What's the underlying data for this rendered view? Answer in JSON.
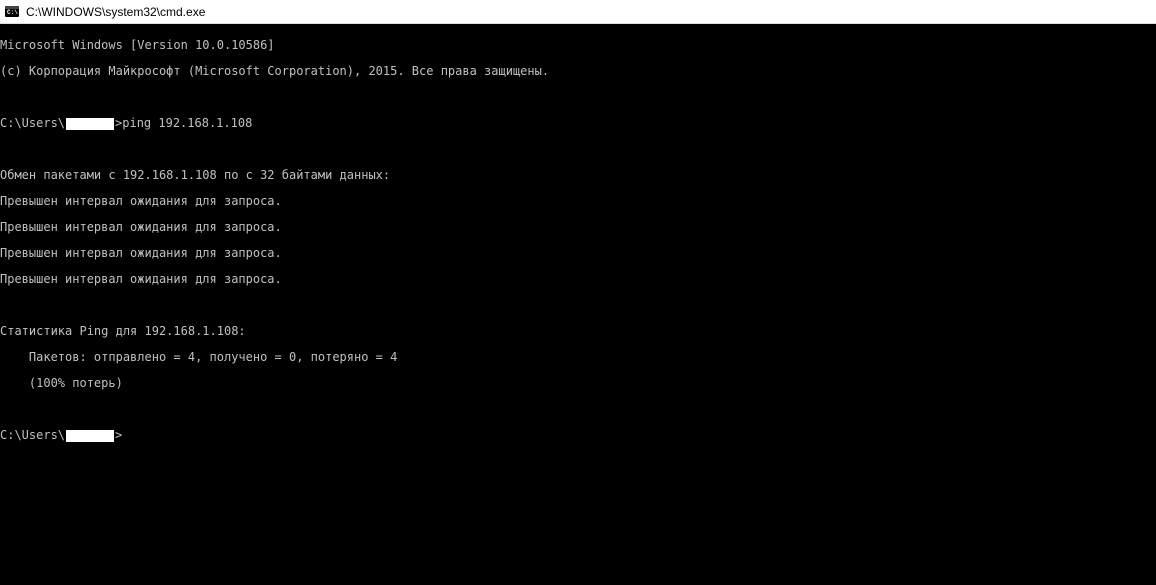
{
  "titlebar": {
    "title": "C:\\WINDOWS\\system32\\cmd.exe",
    "icon_label": "C:\\"
  },
  "terminal": {
    "header_line1": "Microsoft Windows [Version 10.0.10586]",
    "header_line2": "(c) Корпорация Майкрософт (Microsoft Corporation), 2015. Все права защищены.",
    "prompt1_prefix": "C:\\Users\\",
    "prompt1_command": ">ping 192.168.1.108",
    "output_exchange": "Обмен пакетами с 192.168.1.108 по с 32 байтами данных:",
    "output_timeout1": "Превышен интервал ожидания для запроса.",
    "output_timeout2": "Превышен интервал ожидания для запроса.",
    "output_timeout3": "Превышен интервал ожидания для запроса.",
    "output_timeout4": "Превышен интервал ожидания для запроса.",
    "output_stats_header": "Статистика Ping для 192.168.1.108:",
    "output_stats_packets": "    Пакетов: отправлено = 4, получено = 0, потеряно = 4",
    "output_stats_loss": "    (100% потерь)",
    "prompt2_prefix": "C:\\Users\\",
    "prompt2_suffix": ">"
  }
}
